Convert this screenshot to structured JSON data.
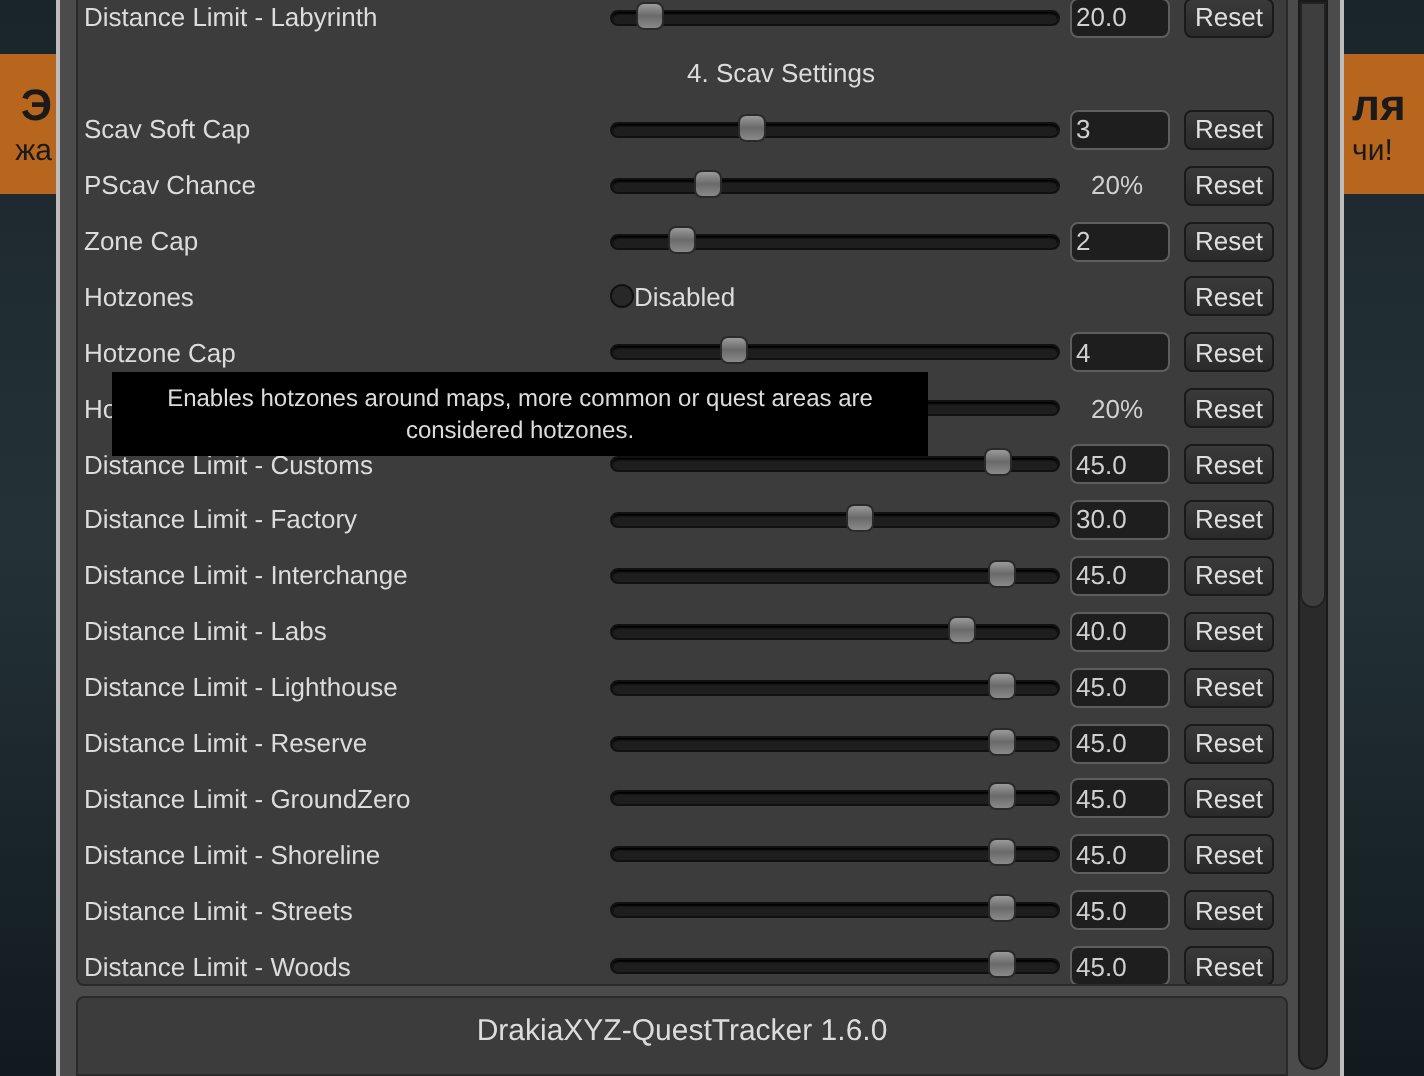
{
  "background": {
    "left_lines": [
      "Э",
      "жа"
    ],
    "right_lines": [
      "ля",
      "чи!"
    ]
  },
  "settings": [
    {
      "kind": "slider",
      "label": "Distance Limit - Labyrinth",
      "level": 0.09,
      "value": "20.0",
      "reset": "Reset"
    },
    {
      "kind": "header",
      "label": "4. Scav Settings"
    },
    {
      "kind": "slider",
      "label": "Scav Soft Cap",
      "level": 0.32,
      "value": "3",
      "reset": "Reset"
    },
    {
      "kind": "percent",
      "label": "PScav Chance",
      "level": 0.22,
      "reading": "20%",
      "reset": "Reset"
    },
    {
      "kind": "slider",
      "label": "Zone Cap",
      "level": 0.16,
      "value": "2",
      "reset": "Reset"
    },
    {
      "kind": "toggle",
      "label": "Hotzones",
      "checked": false,
      "state_text": "Disabled",
      "reset": "Reset"
    },
    {
      "kind": "slider",
      "label": "Hotzone Cap",
      "level": 0.28,
      "value": "4",
      "reset": "Reset"
    },
    {
      "kind": "percent",
      "label": "Ho",
      "reading": "20%",
      "reset": "Reset"
    },
    {
      "kind": "slider",
      "label": "Distance Limit - Customs",
      "level": 0.87,
      "value": "45.0",
      "reset": "Reset"
    },
    {
      "kind": "slider",
      "label": "Distance Limit - Factory",
      "level": 0.56,
      "value": "30.0",
      "reset": "Reset"
    },
    {
      "kind": "slider",
      "label": "Distance Limit - Interchange",
      "level": 0.88,
      "value": "45.0",
      "reset": "Reset"
    },
    {
      "kind": "slider",
      "label": "Distance Limit - Labs",
      "level": 0.79,
      "value": "40.0",
      "reset": "Reset"
    },
    {
      "kind": "slider",
      "label": "Distance Limit - Lighthouse",
      "level": 0.88,
      "value": "45.0",
      "reset": "Reset"
    },
    {
      "kind": "slider",
      "label": "Distance Limit - Reserve",
      "level": 0.88,
      "value": "45.0",
      "reset": "Reset"
    },
    {
      "kind": "slider",
      "label": "Distance Limit - GroundZero",
      "level": 0.88,
      "value": "45.0",
      "reset": "Reset"
    },
    {
      "kind": "slider",
      "label": "Distance Limit - Shoreline",
      "level": 0.88,
      "value": "45.0",
      "reset": "Reset"
    },
    {
      "kind": "slider",
      "label": "Distance Limit - Streets",
      "level": 0.88,
      "value": "45.0",
      "reset": "Reset"
    },
    {
      "kind": "slider",
      "label": "Distance Limit - Woods",
      "level": 0.88,
      "value": "45.0",
      "reset": "Reset"
    }
  ],
  "tooltip": "Enables hotzones around maps, more common or quest areas are considered hotzones.",
  "footer": "DrakiaXYZ-QuestTracker 1.6.0"
}
